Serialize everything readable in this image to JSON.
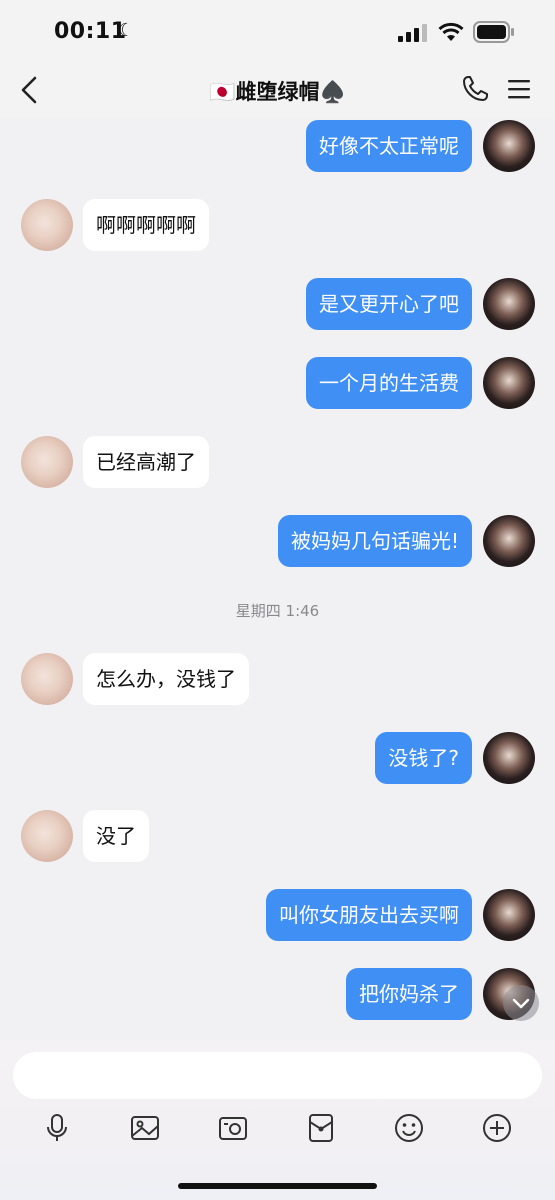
{
  "status_bar": {
    "time": "00:11"
  },
  "header": {
    "title": "🇯🇵雌堕绿帽♠️"
  },
  "messages": [
    {
      "side": "me",
      "text": "好像不太正常呢"
    },
    {
      "side": "other",
      "text": "啊啊啊啊啊"
    },
    {
      "side": "me",
      "text": "是又更开心了吧"
    },
    {
      "side": "me",
      "text": "一个月的生活费"
    },
    {
      "side": "other",
      "text": "已经高潮了"
    },
    {
      "side": "me",
      "text": "被妈妈几句话骗光!"
    },
    {
      "side": "timestamp",
      "text": "星期四 1:46"
    },
    {
      "side": "other",
      "text": "怎么办，没钱了"
    },
    {
      "side": "me",
      "text": "没钱了?"
    },
    {
      "side": "other",
      "text": "没了"
    },
    {
      "side": "me",
      "text": "叫你女朋友出去买啊"
    },
    {
      "side": "me",
      "text": "把你妈杀了"
    }
  ],
  "input": {
    "placeholder": ""
  },
  "toolbar": {
    "icons": [
      "microphone-icon",
      "image-icon",
      "camera-icon",
      "red-packet-icon",
      "emoji-icon",
      "plus-icon"
    ]
  },
  "colors": {
    "my_bubble": "#3f8ff5",
    "other_bubble": "#ffffff",
    "background": "#f1f1f3"
  }
}
